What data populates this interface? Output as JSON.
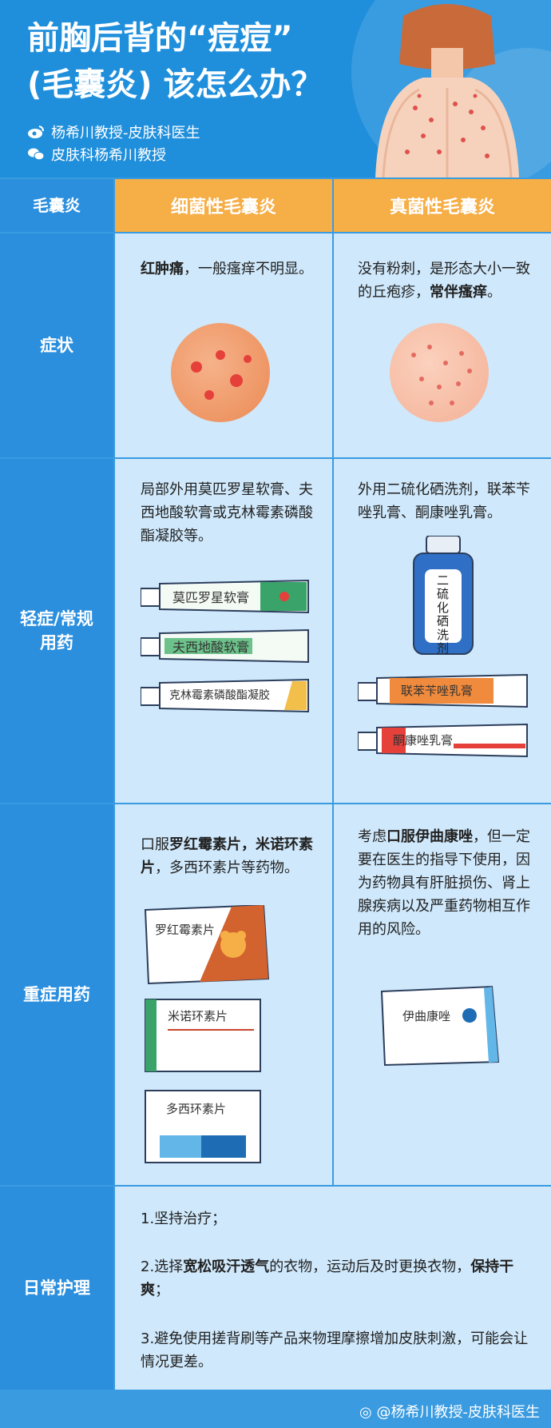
{
  "header": {
    "title_line1": "前胸后背的“痘痘”",
    "title_line2": "(毛囊炎) 该怎么办？",
    "author_weibo": "杨希川教授-皮肤科医生",
    "author_wechat": "皮肤科杨希川教授"
  },
  "table": {
    "col_header_label": "毛囊炎",
    "col_bacterial": "细菌性毛囊炎",
    "col_fungal": "真菌性毛囊炎",
    "row_symptom": "症状",
    "symptom_bacterial_bold": "红肿痛",
    "symptom_bacterial_rest": "，一般瘙痒不明显。",
    "symptom_fungal_plain": "没有粉刺，是形态大小一致的丘疱疹，",
    "symptom_fungal_bold": "常伴瘙痒",
    "symptom_fungal_end": "。",
    "row_mild_line1": "轻症/常规",
    "row_mild_line2": "用药",
    "mild_bacterial": "局部外用莫匹罗星软膏、夫西地酸软膏或克林霉素磷酸酯凝胶等。",
    "mild_fungal": "外用二硫化硒洗剂，联苯苄唑乳膏、酮康唑乳膏。",
    "tube1": "莫匹罗星软膏",
    "tube2": "夫西地酸软膏",
    "tube3": "克林霉素磷酸酯凝胶",
    "bottle": "二硫化硒洗剂",
    "tube4": "联苯苄唑乳膏",
    "tube5": "酮康唑乳膏",
    "row_severe": "重症用药",
    "severe_bacterial_1": "口服",
    "severe_bacterial_bold": "罗红霉素片，米诺环素片",
    "severe_bacterial_2": "，多西环素片等药物。",
    "severe_fungal_1": "考虑",
    "severe_fungal_bold": "口服伊曲康唑",
    "severe_fungal_2": "，但一定要在医生的指导下使用，因为药物具有肝脏损伤、肾上腺疾病以及严重药物相互作用的风险。",
    "box1": "罗红霉素片",
    "box2": "米诺环素片",
    "box3": "多西环素片",
    "box4": "伊曲康唑",
    "row_care": "日常护理",
    "care1": "1.坚持治疗；",
    "care2_a": "2.选择",
    "care2_bold": "宽松吸汗透气",
    "care2_b": "的衣物，运动后及时更换衣物，",
    "care2_bold2": "保持干爽",
    "care2_c": "；",
    "care3": "3.避免使用搓背刷等产品来物理摩擦增加皮肤刺激，可能会让情况更差。"
  },
  "footer": {
    "watermark": "@杨希川教授-皮肤科医生"
  },
  "colors": {
    "blue": "#2b8fde",
    "orange": "#f6ae46",
    "cell": "#cfe8fb"
  }
}
